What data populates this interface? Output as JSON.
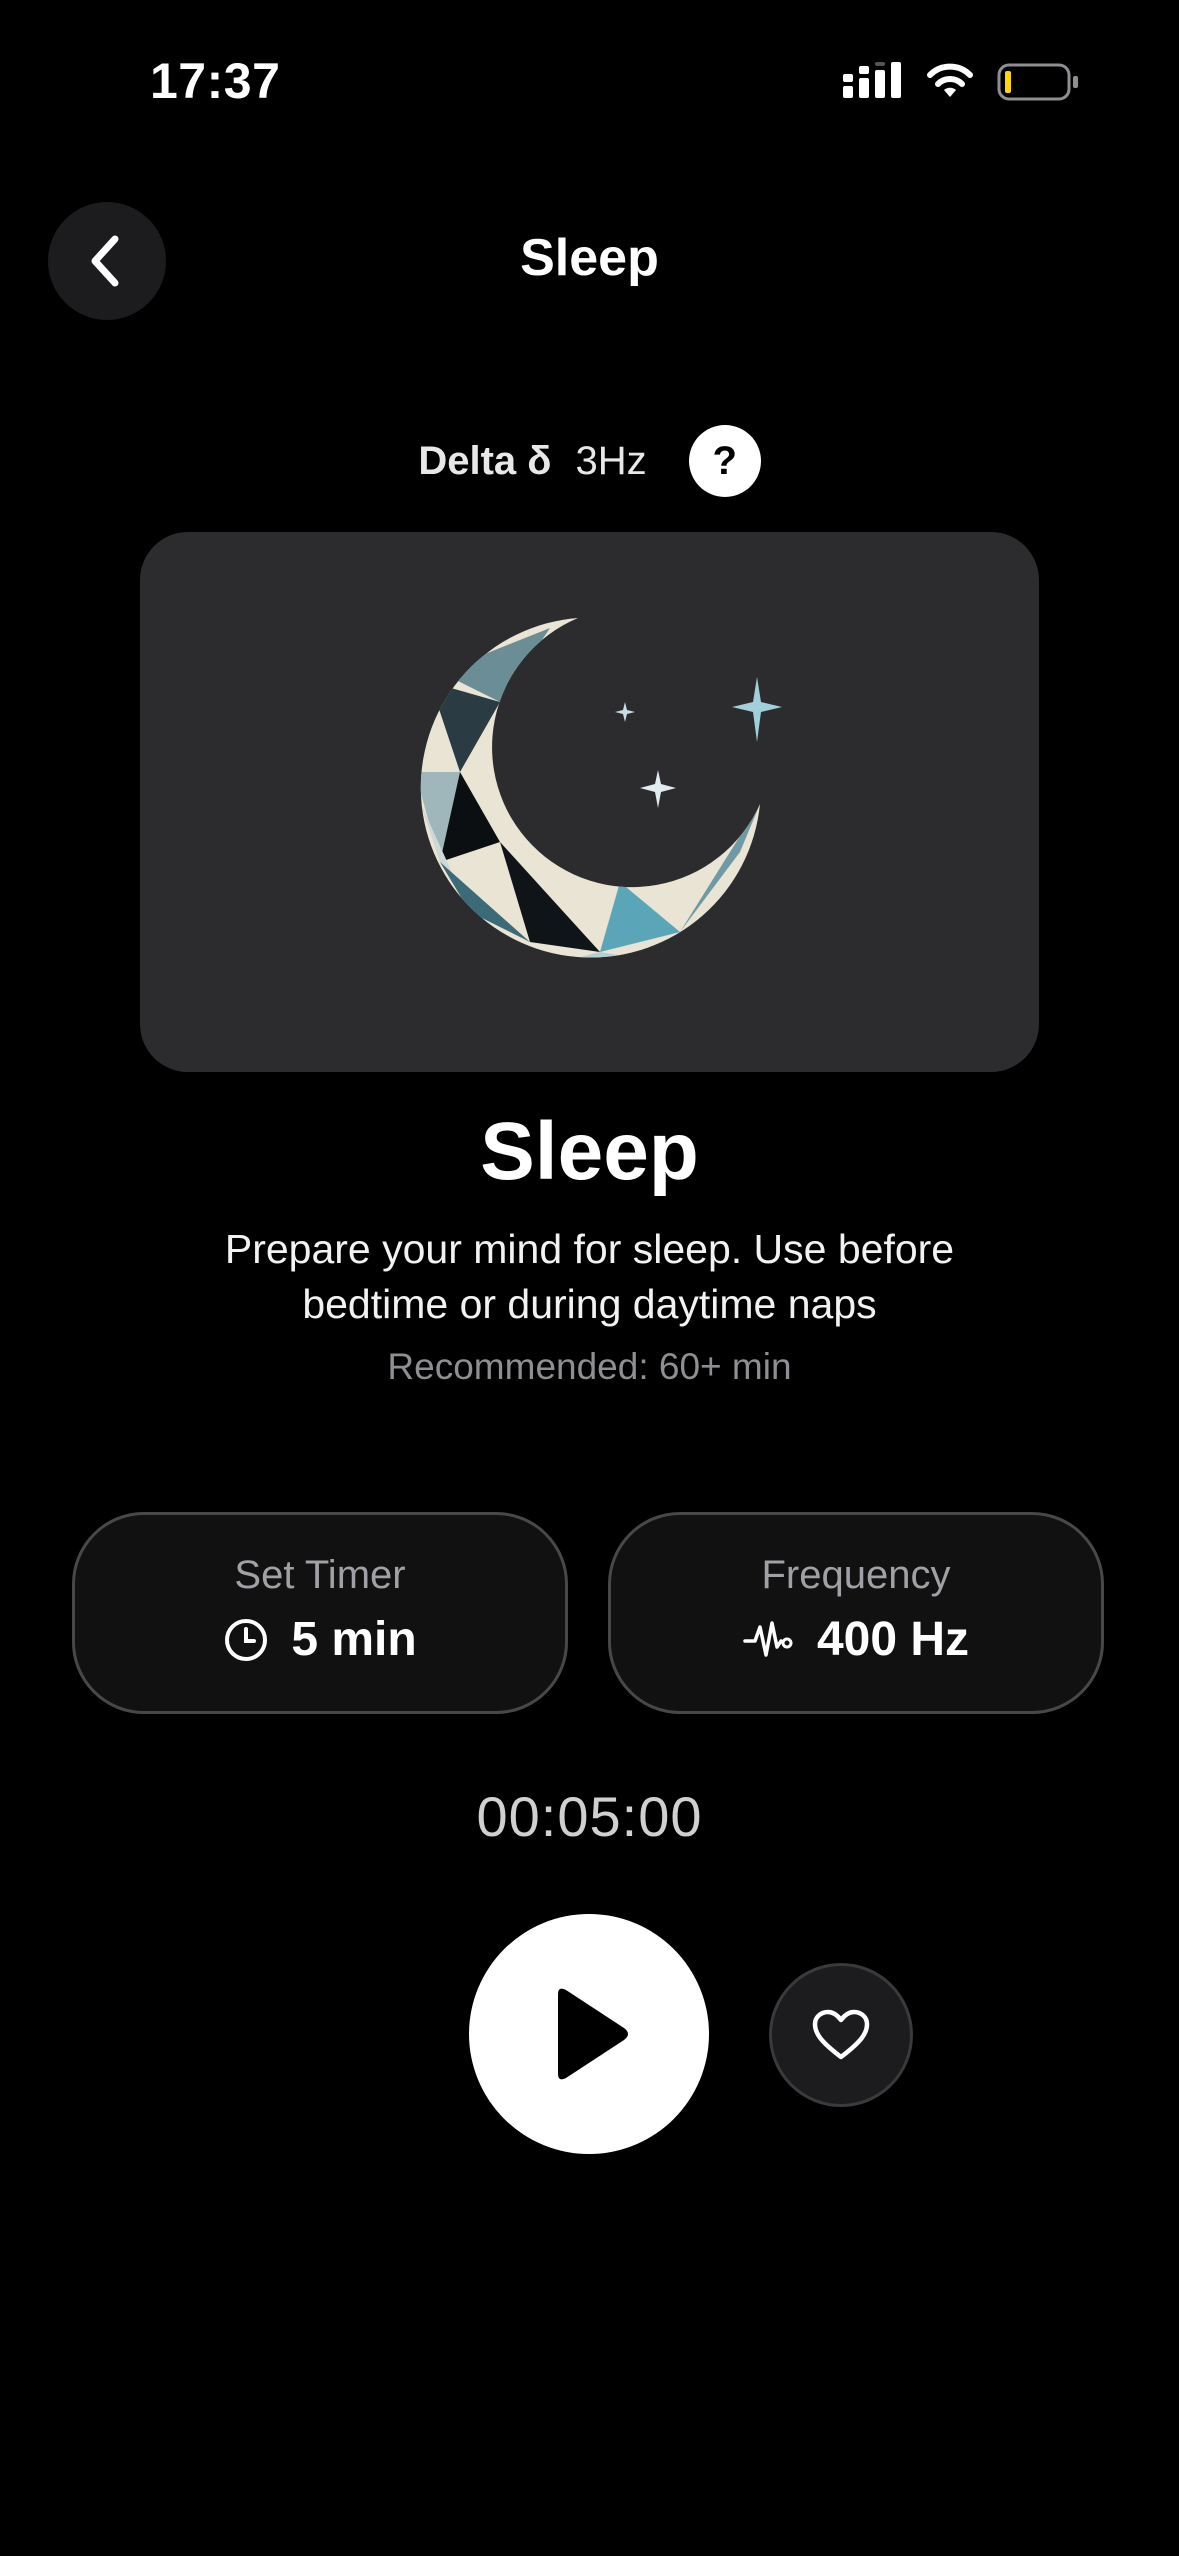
{
  "status_bar": {
    "time": "17:37",
    "signal_icon": "cellular-signal-icon",
    "wifi_icon": "wifi-icon",
    "battery_icon": "battery-low-icon",
    "battery_accent": "#ffd60a"
  },
  "header": {
    "back_icon": "chevron-left-icon",
    "title": "Sleep"
  },
  "wave": {
    "name": "Delta δ",
    "frequency": "3Hz",
    "help_label": "?"
  },
  "artwork": {
    "icon": "crescent-moon-stars-icon"
  },
  "session": {
    "title": "Sleep",
    "description": "Prepare your mind for sleep. Use before bedtime or during daytime naps",
    "recommended": "Recommended: 60+ min"
  },
  "settings": {
    "timer": {
      "label": "Set Timer",
      "value": "5 min",
      "icon": "clock-icon"
    },
    "frequency": {
      "label": "Frequency",
      "value": "400 Hz",
      "icon": "waveform-icon"
    }
  },
  "player": {
    "countdown": "00:05:00",
    "play_icon": "play-icon",
    "favorite_icon": "heart-icon"
  },
  "colors": {
    "background": "#000000",
    "card": "#2c2c2e",
    "button_dark": "#1c1c1e",
    "accent_teal": "#5aa6b8"
  }
}
